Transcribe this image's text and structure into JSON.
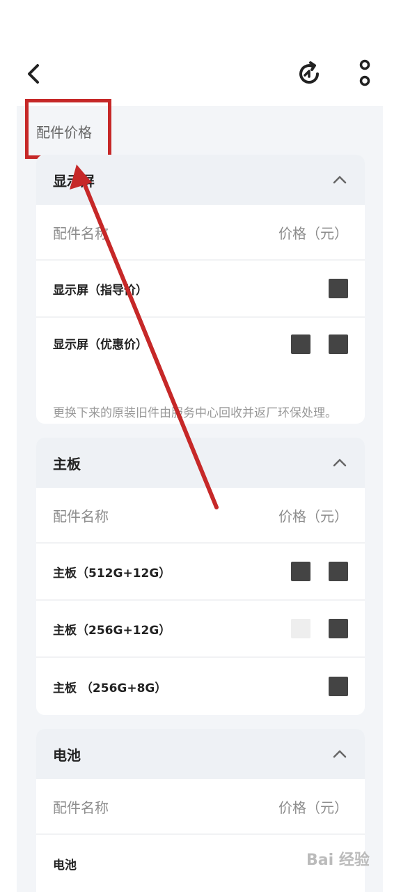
{
  "page": {
    "section_title": "配件价格"
  },
  "cards": [
    {
      "title": "显示屏",
      "header_name": "配件名称",
      "header_price": "价格（元）",
      "items": [
        {
          "name": "显示屏（指导价）"
        },
        {
          "name": "显示屏（优惠价）",
          "note": "更换下来的原装旧件由服务中心回收并返厂环保处理。"
        }
      ]
    },
    {
      "title": "主板",
      "header_name": "配件名称",
      "header_price": "价格（元）",
      "items": [
        {
          "name": "主板（512G+12G）"
        },
        {
          "name": "主板（256G+12G）"
        },
        {
          "name": "主板 （256G+8G）"
        }
      ]
    },
    {
      "title": "电池",
      "header_name": "配件名称",
      "header_price": "价格（元）",
      "items": [
        {
          "name": "电池"
        }
      ]
    }
  ],
  "icons": {
    "back": "chevron-left-icon",
    "refresh": "refresh-icon",
    "more": "more-vertical-icon",
    "collapse": "chevron-up-icon"
  },
  "colors": {
    "annotation_red": "#c62828",
    "card_header_bg": "#eef1f5",
    "page_bg": "#f3f5f8"
  },
  "watermark": "Bai 经验"
}
